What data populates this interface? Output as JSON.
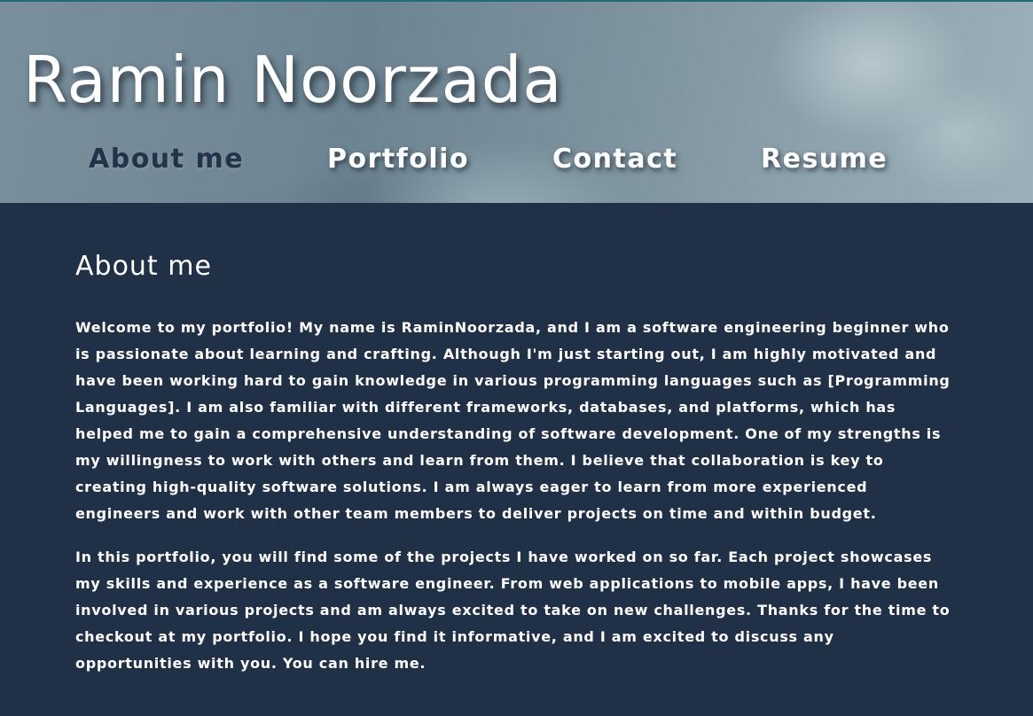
{
  "header": {
    "title": "Ramin Noorzada"
  },
  "nav": {
    "items": [
      {
        "label": "About me",
        "active": true
      },
      {
        "label": "Portfolio",
        "active": false
      },
      {
        "label": "Contact",
        "active": false
      },
      {
        "label": "Resume",
        "active": false
      }
    ]
  },
  "main": {
    "title": "About me",
    "paragraphs": [
      "Welcome to my portfolio! My name is RaminNoorzada, and I am a software engineering beginner who is passionate about learning and crafting. Although I'm just starting out, I am highly motivated and have been working hard to gain knowledge in various programming languages such as [Programming Languages]. I am also familiar with different frameworks, databases, and platforms, which has helped me to gain a comprehensive understanding of software development. One of my strengths is my willingness to work with others and learn from them. I believe that collaboration is key to creating high-quality software solutions. I am always eager to learn from more experienced engineers and work with other team members to deliver projects on time and within budget.",
      "In this portfolio, you will find some of the projects I have worked on so far. Each project showcases my skills and experience as a software engineer. From web applications to mobile apps, I have been involved in various projects and am always excited to take on new challenges. Thanks for the time to checkout at my portfolio. I hope you find it informative, and I am excited to discuss any opportunities with you. You can hire me."
    ]
  },
  "colors": {
    "background": "#203047",
    "text": "#ffffff",
    "active_nav": "#25334a",
    "header_border": "#1f6d73"
  }
}
